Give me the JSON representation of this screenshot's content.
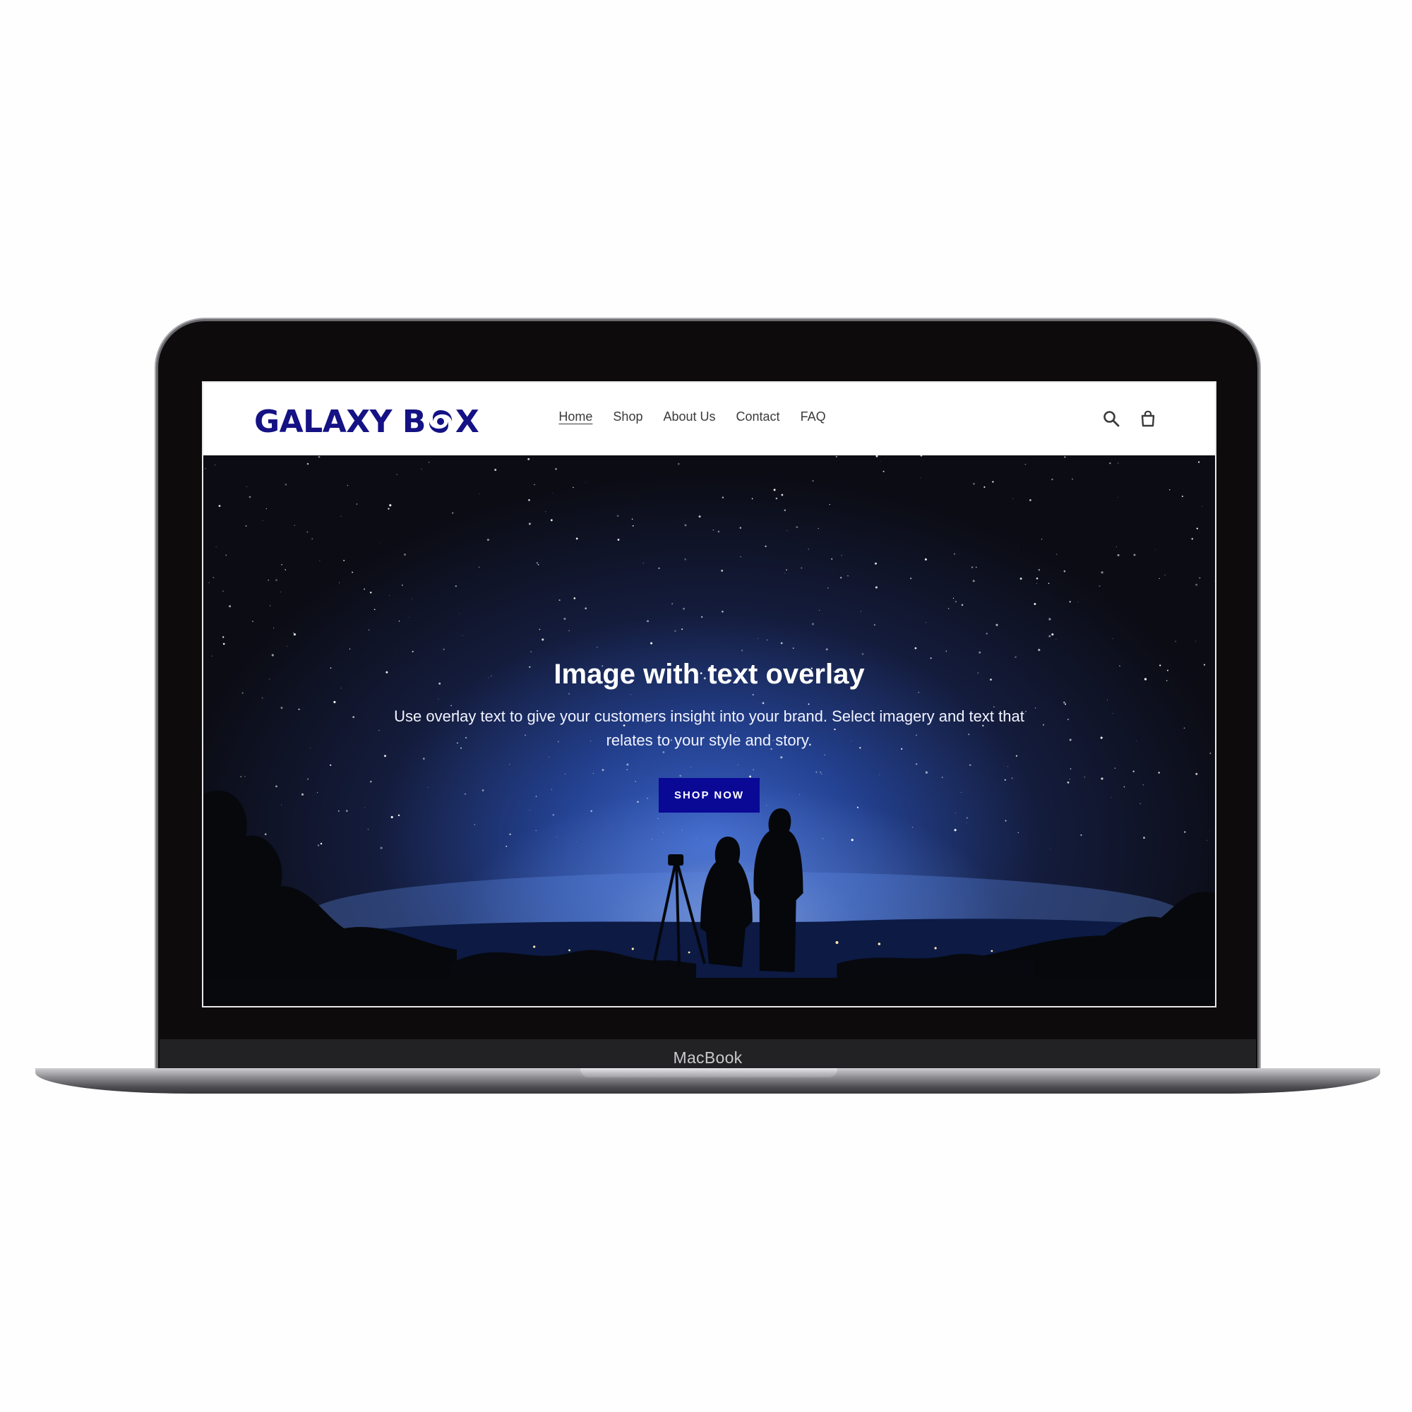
{
  "device": {
    "label": "MacBook"
  },
  "header": {
    "logo": {
      "text_before": "GALAXY B",
      "text_after": "X",
      "color": "#141284"
    },
    "nav": [
      {
        "label": "Home",
        "active": true
      },
      {
        "label": "Shop",
        "active": false
      },
      {
        "label": "About Us",
        "active": false
      },
      {
        "label": "Contact",
        "active": false
      },
      {
        "label": "FAQ",
        "active": false
      }
    ],
    "icons": [
      "search-icon",
      "cart-icon"
    ]
  },
  "hero": {
    "title": "Image with text overlay",
    "subtitle": "Use overlay text to give your customers insight into your brand. Select imagery and text that relates to your style and story.",
    "button_label": "SHOP NOW",
    "button_color": "#0a0996"
  }
}
